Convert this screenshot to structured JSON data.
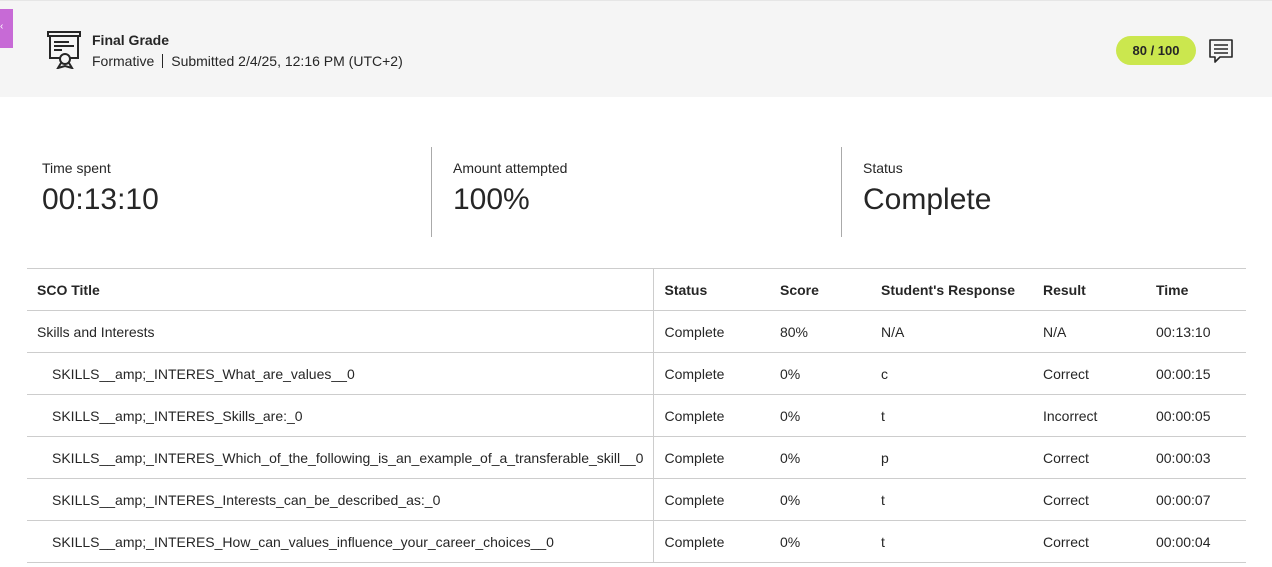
{
  "header": {
    "side_tab_glyph": "‹",
    "title": "Final Grade",
    "type": "Formative",
    "submitted": "Submitted 2/4/25, 12:16 PM (UTC+2)",
    "score": "80 / 100",
    "icons": {
      "grade": "certificate-grade-icon",
      "feedback": "feedback-comment-icon"
    },
    "colors": {
      "score_pill": "#cbe74e",
      "side_tab": "#c76ad6"
    }
  },
  "stats": [
    {
      "label": "Time spent",
      "value": "00:13:10"
    },
    {
      "label": "Amount attempted",
      "value": "100%"
    },
    {
      "label": "Status",
      "value": "Complete"
    }
  ],
  "table": {
    "columns": [
      "SCO Title",
      "Status",
      "Score",
      "Student's Response",
      "Result",
      "Time"
    ],
    "rows": [
      {
        "title": "Skills and Interests",
        "status": "Complete",
        "score": "80%",
        "response": "N/A",
        "result": "N/A",
        "time": "00:13:10"
      },
      {
        "title": "SKILLS__amp;_INTERES_What_are_values__0",
        "status": "Complete",
        "score": "0%",
        "response": "c",
        "result": "Correct",
        "time": "00:00:15"
      },
      {
        "title": "SKILLS__amp;_INTERES_Skills_are:_0",
        "status": "Complete",
        "score": "0%",
        "response": "t",
        "result": "Incorrect",
        "time": "00:00:05"
      },
      {
        "title": "SKILLS__amp;_INTERES_Which_of_the_following_is_an_example_of_a_transferable_skill__0",
        "status": "Complete",
        "score": "0%",
        "response": "p",
        "result": "Correct",
        "time": "00:00:03"
      },
      {
        "title": "SKILLS__amp;_INTERES_Interests_can_be_described_as:_0",
        "status": "Complete",
        "score": "0%",
        "response": "t",
        "result": "Correct",
        "time": "00:00:07"
      },
      {
        "title": "SKILLS__amp;_INTERES_How_can_values_influence_your_career_choices__0",
        "status": "Complete",
        "score": "0%",
        "response": "t",
        "result": "Correct",
        "time": "00:00:04"
      }
    ]
  }
}
